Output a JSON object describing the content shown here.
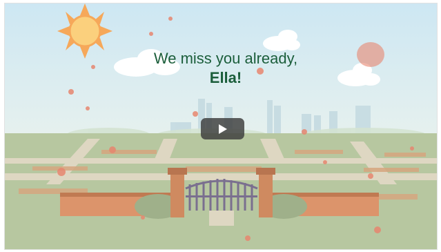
{
  "video": {
    "headline_line1": "We miss you already,",
    "headline_line2": "Ella!",
    "play_icon": "play-icon",
    "colors": {
      "sky": "#cfe8f2",
      "headline": "#1b5e3b",
      "lawn": "#b9c9a2",
      "brick": "#d9906a",
      "play_button": "#3c3c3c"
    }
  }
}
